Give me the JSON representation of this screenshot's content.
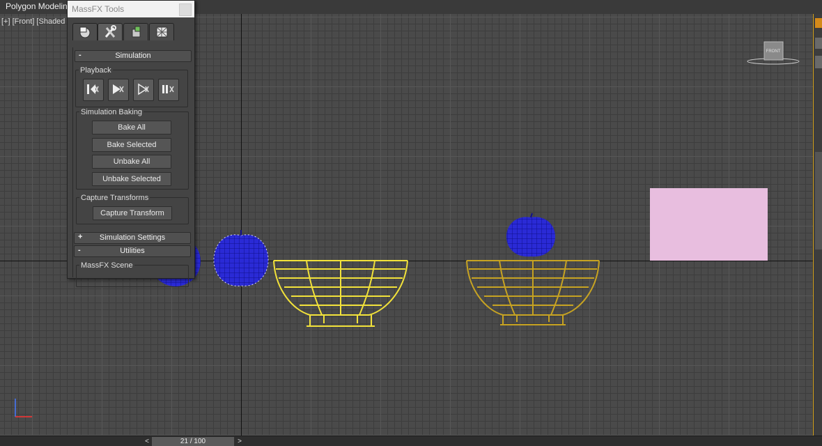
{
  "app": {
    "title": "Polygon Modelin"
  },
  "viewport": {
    "label": "[+] [Front] [Shaded",
    "viewcube_label": "FRONT"
  },
  "timeline": {
    "position_text": "21 / 100",
    "prev_label": "<",
    "next_label": ">"
  },
  "massfx": {
    "title": "MassFX Tools",
    "tabs": [
      {
        "icon": "world-icon"
      },
      {
        "icon": "tools-icon"
      },
      {
        "icon": "rigid-body-icon"
      },
      {
        "icon": "display-icon"
      }
    ],
    "active_tab_index": 1,
    "simulation_rollout": {
      "sign": "-",
      "title": "Simulation"
    },
    "playback_group": {
      "title": "Playback"
    },
    "simulation_baking_group": {
      "title": "Simulation Baking",
      "buttons": [
        "Bake All",
        "Bake Selected",
        "Unbake All",
        "Unbake Selected"
      ]
    },
    "capture_transforms_group": {
      "title": "Capture Transforms",
      "button": "Capture Transform"
    },
    "simulation_settings_rollout": {
      "sign": "+",
      "title": "Simulation Settings"
    },
    "utilities_rollout": {
      "sign": "-",
      "title": "Utilities"
    },
    "massfx_scene_group": {
      "title": "MassFX Scene"
    }
  },
  "colors": {
    "viewport_bg": "#4a4a4a",
    "apple_blue": "#2222cc",
    "bowl_selected": "#f2e23a",
    "bowl_unselected": "#c7a322",
    "box_pink": "#e8bedf",
    "active_border": "#d4a21a"
  }
}
